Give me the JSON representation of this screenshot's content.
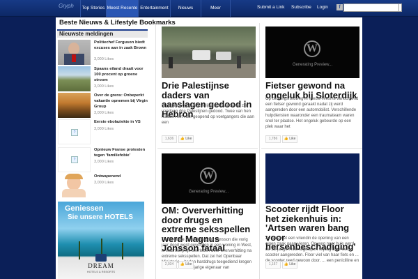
{
  "header": {
    "logo": "Gryph",
    "nav": [
      "Top Stories",
      "Meest Recente",
      "Entertainment",
      "Nieuws",
      "Meer"
    ],
    "utility": [
      "Submit a Link",
      "Subscribe",
      "Login"
    ],
    "fb_icon": "facebook-icon",
    "search_placeholder": ""
  },
  "page": {
    "title": "Beste Nieuws & Lifestyle Bookmarks"
  },
  "sidebar": {
    "heading": "Nieuwste meldingen",
    "items": [
      {
        "title": "Politiechef Ferguson biedt excuses aan in zaak Brown",
        "likes": "3,000 Likes"
      },
      {
        "title": "Spaans eiland draait voor 100 procent op groene stroom",
        "likes": "3,000 Likes"
      },
      {
        "title": "Over de grens: Onbeperkt vakantie opnemen bij Virgin Group",
        "likes": "3,000 Likes"
      },
      {
        "title": "Eerste ebolaziekte in VS",
        "likes": "3,000 Likes"
      },
      {
        "title": "Opnieuw Franse protesten tegen 'familiefobie'",
        "likes": "3,000 Likes"
      },
      {
        "title": "Ontwapenend",
        "likes": "3,000 Likes"
      }
    ]
  },
  "ad": {
    "line1": "Geniessen",
    "line2": "Sie unsere HOTELS",
    "brand": "DREAM",
    "sub": "HOTELS & RESORTS"
  },
  "cards": [
    {
      "title": "Drie Palestijnse daders van aanslagen gedood in Hebron",
      "body": "In Hebron, op de Westelijke Jordaanoever, zijn vandaag drie Palestijnen gedood. Twee van hen hadden het vuur geopend op voetgangers die aan een",
      "count": "1,636",
      "like": "Like"
    },
    {
      "title": "Fietser gewond na ongeluk bij Sloterdijk",
      "body": "Op de Kingsfordweg in Nieuw-West is vanochtend een fietser gewond geraakt nadat zij werd aangereden door een automobilist. Verschillende hulpdiensten waaronder een traumateam waren snel ter plaatse. Het ongeluk gebeurde op een plek waar het",
      "count": "1,786",
      "like": "Like",
      "preview": "Generating Preview..."
    },
    {
      "title": "OM: Oververhitting door drugs en extreme seksspellen werd Magnus Jonsson fataal",
      "body": "De 35-jarige Zweed Magnus Jonsson die vorig jaar dood werd gevonden in een woning in West, is waarschijnlijk overleden door oververhitting na extreme seksspellen. Dat zei het Openbaar Ministerie... heden harddrugs toegediend kregen aan de... . De 56-jarige eigenaar van",
      "count": "2,034",
      "like": "Like",
      "preview": "Generating Preview..."
    },
    {
      "title": "Scooter rijdt Floor het ziekenhuis in: 'Artsen waren bang voor hersenbeschadiging'",
      "body": "Ze was met een vriendin de opening van een eigen zaak gaan vieren. Op weg naar huis werd de 28-jarige Floor afgelopen vrijdag door een scooter aangereden. Floor viel van haar fiets en ... de scooter reed gewoon door. ... een penicilline en morfine",
      "count": "1,157",
      "like": "Like"
    }
  ]
}
